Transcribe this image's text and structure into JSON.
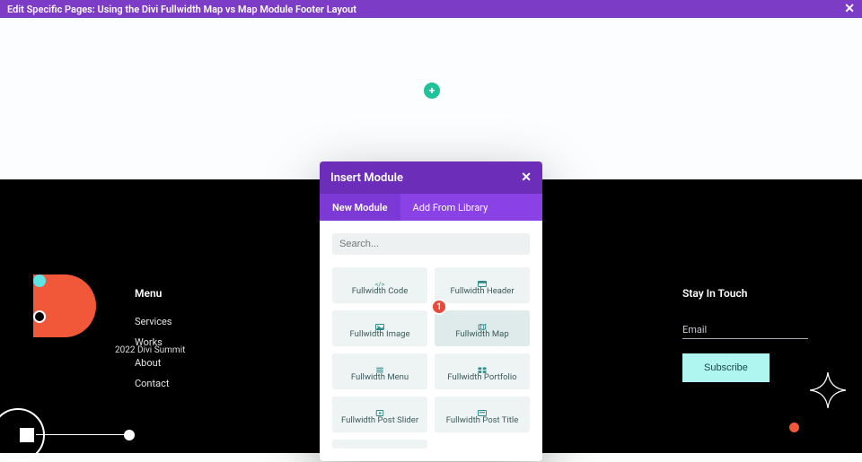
{
  "topbar": {
    "title": "Edit Specific Pages: Using the Divi Fullwidth Map vs Map Module Footer Layout"
  },
  "canvas": {
    "add_label": "+"
  },
  "modal": {
    "title": "Insert Module",
    "tabs": {
      "new": "New Module",
      "library": "Add From Library"
    },
    "search_placeholder": "Search...",
    "modules": [
      {
        "label": "Fullwidth Code",
        "icon": "code"
      },
      {
        "label": "Fullwidth Header",
        "icon": "header"
      },
      {
        "label": "Fullwidth Image",
        "icon": "image"
      },
      {
        "label": "Fullwidth Map",
        "icon": "map",
        "hover": true
      },
      {
        "label": "Fullwidth Menu",
        "icon": "menu"
      },
      {
        "label": "Fullwidth Portfolio",
        "icon": "portfolio"
      },
      {
        "label": "Fullwidth Post Slider",
        "icon": "slider"
      },
      {
        "label": "Fullwidth Post Title",
        "icon": "title"
      }
    ],
    "badge": "1"
  },
  "footer": {
    "logo_caption": "2022 Divi Summit",
    "menu": {
      "heading": "Menu",
      "links": [
        "Services",
        "Works",
        "About",
        "Contact"
      ]
    },
    "stay": {
      "heading": "Stay In Touch",
      "email_label": "Email",
      "subscribe": "Subscribe"
    }
  }
}
